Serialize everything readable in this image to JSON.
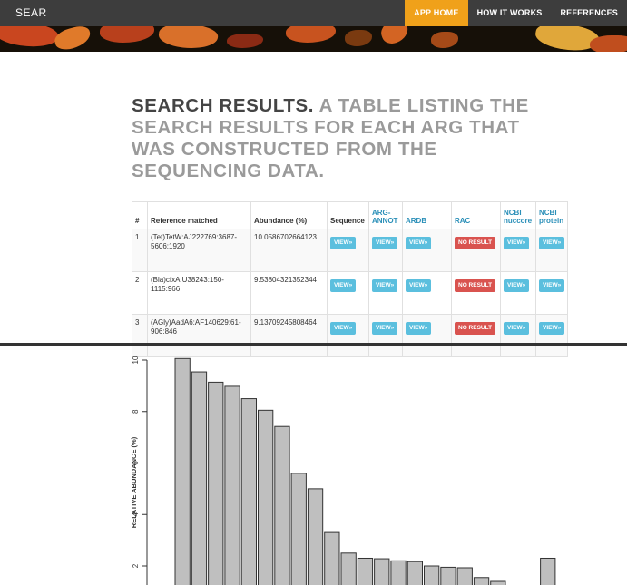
{
  "nav": {
    "brand": "SEAR",
    "items": [
      "APP HOME",
      "HOW IT WORKS",
      "REFERENCES"
    ]
  },
  "heading": {
    "strong": "SEARCH RESULTS.",
    "soft": "A TABLE LISTING THE SEARCH RESULTS FOR EACH ARG THAT WAS CONSTRUCTED FROM THE SEQUENCING DATA."
  },
  "table": {
    "headers": {
      "num": "#",
      "ref": "Reference matched",
      "abund": "Abundance (%)",
      "seq": "Sequence",
      "argannot": "ARG-ANNOT",
      "ardb": "ARDB",
      "rac": "RAC",
      "nuccore": "NCBI nuccore",
      "protein": "NCBI protein"
    },
    "view_label": "VIEW»",
    "no_result_label": "NO RESULT",
    "rows": [
      {
        "num": "1",
        "ref": "(Tet)TetW:AJ222769:3687-5606:1920",
        "abund": "10.0586702664123"
      },
      {
        "num": "2",
        "ref": "(Bla)cfxA:U38243:150-1115:966",
        "abund": "9.53804321352344"
      },
      {
        "num": "3",
        "ref": "(AGly)AadA6:AF140629:61-906:846",
        "abund": "9.13709245808464"
      }
    ]
  },
  "chart_data": {
    "type": "bar",
    "ylabel": "RELATIVE ABUNDANCE (%)",
    "yticks": [
      2,
      4,
      6,
      8,
      10
    ],
    "ylim": [
      0,
      10.3
    ],
    "values": [
      10.06,
      9.54,
      9.14,
      8.98,
      8.5,
      8.05,
      7.42,
      5.6,
      5.0,
      3.3,
      2.5,
      2.3,
      2.28,
      2.2,
      2.17,
      2.0,
      1.95,
      1.93,
      1.55,
      1.4,
      0,
      0,
      2.3
    ],
    "colors": {
      "bar": "#bfbfbf",
      "stroke": "#333333"
    }
  }
}
